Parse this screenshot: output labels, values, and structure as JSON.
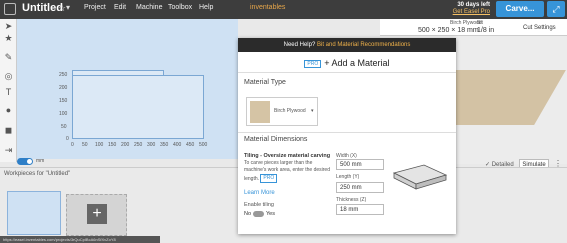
{
  "topbar": {
    "title": "Untitled",
    "menu": [
      "Project",
      "Edit",
      "Machine",
      "Toolbox",
      "Help"
    ],
    "brand": "inventables",
    "trial_days": "30 days left",
    "trial_link": "Get Easel Pro",
    "carve_label": "Carve..."
  },
  "canvas": {
    "y_ticks": [
      "250",
      "200",
      "150",
      "100",
      "50",
      "0"
    ],
    "x_ticks": [
      "0",
      "50",
      "100",
      "150",
      "200",
      "250",
      "300",
      "350",
      "400",
      "450",
      "500"
    ],
    "unit_label": "mm"
  },
  "material_bar": {
    "material_name": "Birch Plywood",
    "dimensions": "500 × 250 × 18 mm",
    "bit_label": "Bit",
    "bit_value": "1/8 in",
    "cut_settings": "Cut Settings"
  },
  "simulate": {
    "detailed_label": "Detailed",
    "simulate_label": "Simulate"
  },
  "workpieces": {
    "title": "Workpieces for \"Untitled\"",
    "status_url": "https://easel.inventables.com/projects/3rQuCpIBcA6nSfXvZoY8"
  },
  "modal": {
    "help_text": "Need Help?",
    "help_link": "Bit and Material Recommendations",
    "pro_badge": "PRO",
    "title": "+ Add a Material",
    "material_type_heading": "Material Type",
    "selected_material": "Birch Plywood",
    "dimensions_heading": "Material Dimensions",
    "tiling_heading": "Tiling - Oversize material carving",
    "tiling_body": "To carve pieces larger than the machine's work area, enter the desired length.",
    "tiling_pro": "PRO",
    "learn_more": "Learn More",
    "enable_tiling": "Enable tiling",
    "no_label": "No",
    "yes_label": "Yes",
    "width_label": "Width (X)",
    "width_value": "500 mm",
    "length_label": "Length (Y)",
    "length_value": "250 mm",
    "thickness_label": "Thickness (Z)",
    "thickness_value": "18 mm"
  },
  "colors": {
    "accent": "#3794d8",
    "brand": "#e6a64a",
    "topbar": "#3d3d3d",
    "canvas": "#cfe1f3"
  }
}
